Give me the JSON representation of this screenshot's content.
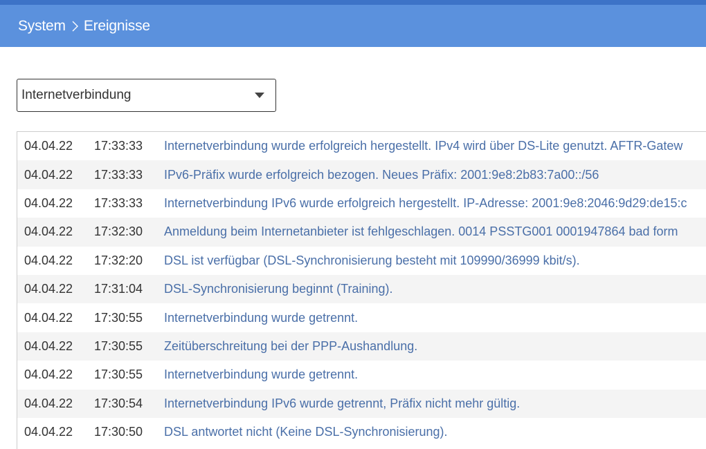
{
  "header": {
    "breadcrumb": [
      "System",
      "Ereignisse"
    ]
  },
  "filter": {
    "selected": "Internetverbindung"
  },
  "events": [
    {
      "date": "04.04.22",
      "time": "17:33:33",
      "message": "Internetverbindung wurde erfolgreich hergestellt. IPv4 wird über DS-Lite genutzt. AFTR-Gatew"
    },
    {
      "date": "04.04.22",
      "time": "17:33:33",
      "message": "IPv6-Präfix wurde erfolgreich bezogen. Neues Präfix: 2001:9e8:2b83:7a00::/56"
    },
    {
      "date": "04.04.22",
      "time": "17:33:33",
      "message": "Internetverbindung IPv6 wurde erfolgreich hergestellt. IP-Adresse: 2001:9e8:2046:9d29:de15:c"
    },
    {
      "date": "04.04.22",
      "time": "17:32:30",
      "message": "Anmeldung beim Internetanbieter ist fehlgeschlagen. 0014 PSSTG001 0001947864 bad form"
    },
    {
      "date": "04.04.22",
      "time": "17:32:20",
      "message": "DSL ist verfügbar (DSL-Synchronisierung besteht mit 109990/36999 kbit/s)."
    },
    {
      "date": "04.04.22",
      "time": "17:31:04",
      "message": "DSL-Synchronisierung beginnt (Training)."
    },
    {
      "date": "04.04.22",
      "time": "17:30:55",
      "message": "Internetverbindung wurde getrennt."
    },
    {
      "date": "04.04.22",
      "time": "17:30:55",
      "message": "Zeitüberschreitung bei der PPP-Aushandlung."
    },
    {
      "date": "04.04.22",
      "time": "17:30:55",
      "message": "Internetverbindung wurde getrennt."
    },
    {
      "date": "04.04.22",
      "time": "17:30:54",
      "message": "Internetverbindung IPv6 wurde getrennt, Präfix nicht mehr gültig."
    },
    {
      "date": "04.04.22",
      "time": "17:30:50",
      "message": "DSL antwortet nicht (Keine DSL-Synchronisierung)."
    }
  ],
  "colors": {
    "header_bg": "#5b91dd",
    "top_strip": "#3d73c7",
    "message_text": "#4a6fa8",
    "row_alt_bg": "#f4f4f4"
  },
  "icons": {
    "breadcrumb_separator": "chevron-right-icon",
    "dropdown": "caret-down-icon"
  }
}
